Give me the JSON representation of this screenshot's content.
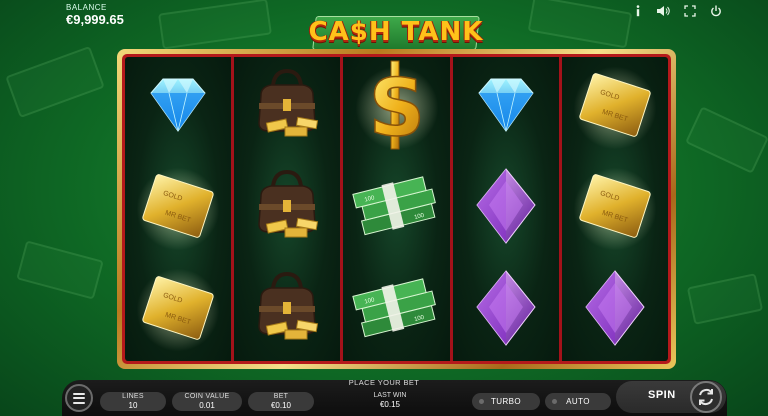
{
  "balance": {
    "label": "BALANCE",
    "value": "€9,999.65"
  },
  "top_icons": [
    "info-icon",
    "sound-icon",
    "fullscreen-icon",
    "power-icon"
  ],
  "logo": {
    "text": "CA$H TANK"
  },
  "reels": [
    [
      "diamond-blue",
      "gold-card",
      "gold-card"
    ],
    [
      "money-bag",
      "money-bag",
      "money-bag"
    ],
    [
      "dollar-sign",
      "cash-stack",
      "cash-stack"
    ],
    [
      "diamond-blue",
      "gem-purple",
      "gem-purple"
    ],
    [
      "gold-card",
      "gold-card",
      "gem-purple"
    ]
  ],
  "controls": {
    "message": "PLACE YOUR BET",
    "lines": {
      "label": "LINES",
      "value": "10"
    },
    "coin_value": {
      "label": "COIN VALUE",
      "value": "0.01"
    },
    "bet": {
      "label": "BET",
      "value": "€0.10"
    },
    "last_win": {
      "label": "LAST WIN",
      "value": "€0.15"
    },
    "turbo": "TURBO",
    "auto": "AUTO",
    "spin": "SPIN"
  },
  "colors": {
    "accent_gold": "#f3c93a",
    "frame_red": "#b4191b",
    "bg_green": "#1f9a3a"
  }
}
